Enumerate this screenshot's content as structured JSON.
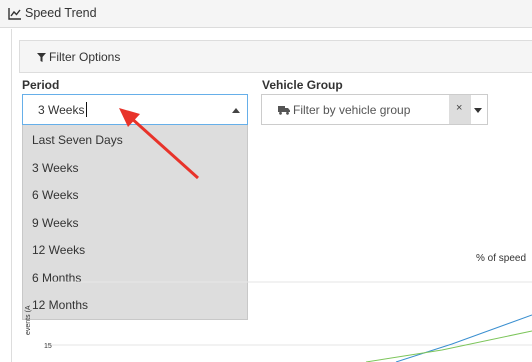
{
  "header": {
    "title": "Speed Trend",
    "icon": "line-chart-icon"
  },
  "filter": {
    "title": "Filter Options",
    "icon": "filter-icon"
  },
  "period": {
    "label": "Period",
    "value": "3 Weeks",
    "options": [
      "Last Seven Days",
      "3 Weeks",
      "6 Weeks",
      "9 Weeks",
      "12 Weeks",
      "6 Months",
      "12 Months"
    ]
  },
  "vehicle_group": {
    "label": "Vehicle Group",
    "placeholder": "Filter by vehicle group",
    "clear_label": "×",
    "icon": "truck-icon"
  },
  "chart": {
    "subtitle": "% of speed",
    "ylabel": "events (A",
    "tick": "15",
    "colors": {
      "blue": "#3a8fd0",
      "green": "#7cc55a"
    }
  },
  "annotation": {
    "arrow_color": "#e8332a"
  }
}
